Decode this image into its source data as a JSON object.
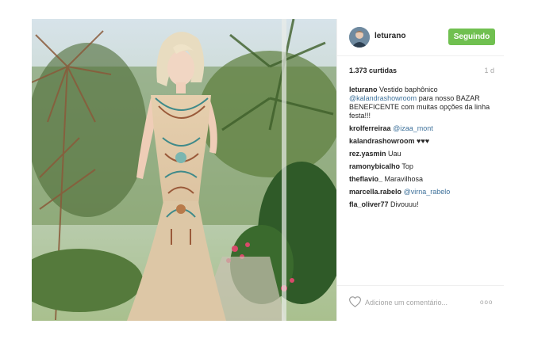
{
  "header": {
    "username": "leturano",
    "follow_label": "Seguindo"
  },
  "stats": {
    "likes": "1.373 curtidas",
    "time_ago": "1 d"
  },
  "comments": [
    {
      "user": "leturano",
      "parts": [
        "Vestido baphônico ",
        "@kalandrashowroom",
        " para nosso BAZAR BENEFICENTE ",
        "",
        "com muitas opções da linha festa!!!"
      ]
    },
    {
      "user": "krolferreiraa",
      "mention": "@izaa_mont",
      "text": ""
    },
    {
      "user": "kalandrashowroom",
      "text": "♥♥♥"
    },
    {
      "user": "rez.yasmin",
      "text": "Uau"
    },
    {
      "user": "ramonybicalho",
      "text": "Top"
    },
    {
      "user": "theflavio_",
      "text": "Maravilhosa"
    },
    {
      "user": "marcella.rabelo",
      "mention": "@virna_rabelo",
      "text": ""
    },
    {
      "user": "fla_oliver77",
      "text": "Divouuu!"
    }
  ],
  "add_comment": {
    "placeholder": "Adicione um comentário...",
    "more": "ooo"
  },
  "colors": {
    "follow_button": "#70c050",
    "mention": "#3f729b",
    "muted": "#a5a5a5",
    "divider": "#efefef"
  },
  "icons": [
    "heart-icon",
    "more-options-icon",
    "avatar"
  ]
}
